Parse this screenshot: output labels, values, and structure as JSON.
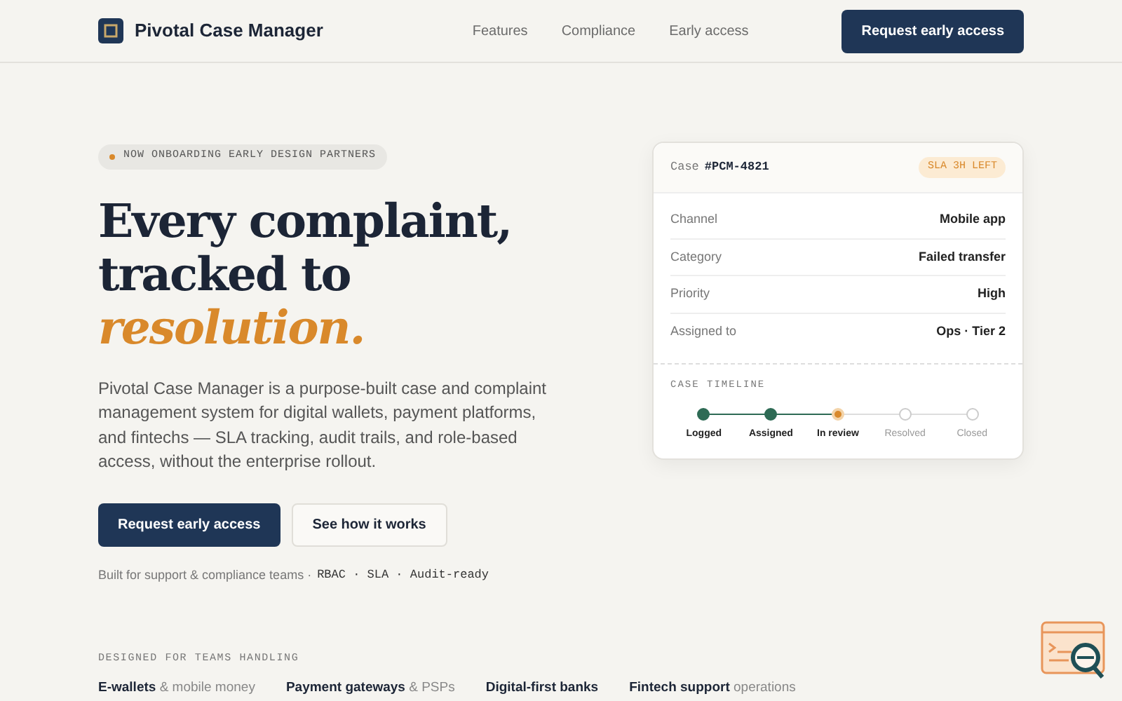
{
  "brand": {
    "name": "Pivotal Case Manager"
  },
  "nav": {
    "links": [
      "Features",
      "Compliance",
      "Early access"
    ],
    "cta": "Request early access"
  },
  "hero": {
    "eyebrow": "NOW ONBOARDING EARLY DESIGN PARTNERS",
    "headline": "Every complaint, tracked to",
    "headline_accent": "resolution.",
    "lead": "Pivotal Case Manager is a purpose-built case and complaint management system for digital wallets, payment platforms, and fintechs — SLA tracking, audit trails, and role-based access, without the enterprise rollout.",
    "primary_button": "Request early access",
    "secondary_button": "See how it works",
    "note": "Built for support & compliance teams ·",
    "tags": "RBAC · SLA · Audit-ready"
  },
  "case_card": {
    "label": "Case",
    "case_id": "#PCM-4821",
    "sla_badge": "SLA 3H LEFT",
    "fields": [
      {
        "label": "Channel",
        "value": "Mobile app"
      },
      {
        "label": "Category",
        "value": "Failed transfer"
      },
      {
        "label": "Priority",
        "value": "High"
      },
      {
        "label": "Assigned to",
        "value": "Ops · Tier 2"
      }
    ],
    "timeline_title": "CASE TIMELINE",
    "steps": [
      {
        "label": "Logged",
        "done": true,
        "current": false
      },
      {
        "label": "Assigned",
        "done": true,
        "current": false
      },
      {
        "label": "In review",
        "done": false,
        "current": true
      },
      {
        "label": "Resolved",
        "done": false,
        "current": false
      },
      {
        "label": "Closed",
        "done": false,
        "current": false
      }
    ]
  },
  "audiences": {
    "title": "DESIGNED FOR TEAMS HANDLING",
    "items": [
      "**E-wallets** & mobile money",
      "**Payment gateways** & PSPs",
      "**Digital-first banks**",
      "**Fintech support** operations"
    ]
  }
}
